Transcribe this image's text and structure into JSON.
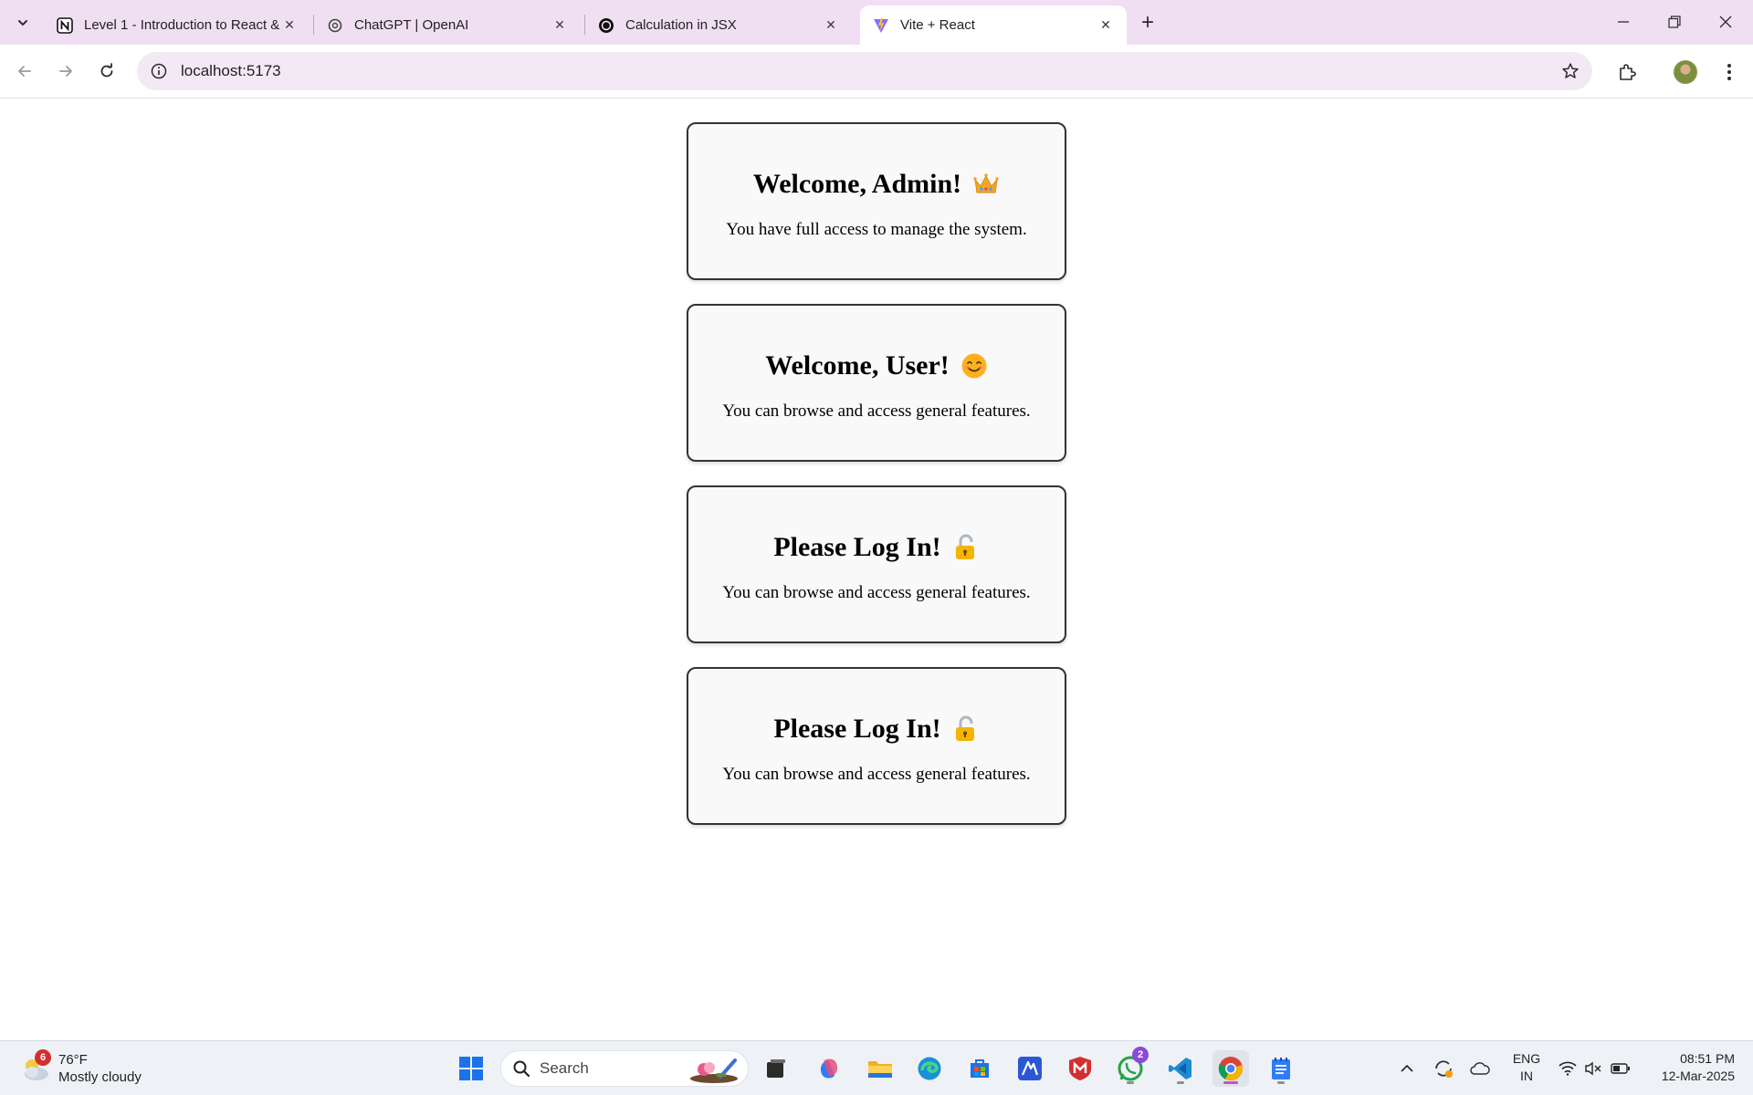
{
  "browser": {
    "tabs": [
      {
        "title": "Level 1 - Introduction to React & ",
        "favicon": "notion-icon",
        "active": false
      },
      {
        "title": "ChatGPT | OpenAI",
        "favicon": "openai-icon",
        "active": false
      },
      {
        "title": "Calculation in JSX",
        "favicon": "openai-icon",
        "active": false
      },
      {
        "title": "Vite + React",
        "favicon": "vite-icon",
        "active": true
      }
    ],
    "url": "localhost:5173"
  },
  "cards": [
    {
      "title": "Welcome, Admin!",
      "emoji": "crown-icon",
      "text": "You have full access to manage the system."
    },
    {
      "title": "Welcome, User!",
      "emoji": "smiling-face-icon",
      "text": "You can browse and access general features."
    },
    {
      "title": "Please Log In!",
      "emoji": "lock-icon",
      "text": "You can browse and access general features."
    },
    {
      "title": "Please Log In!",
      "emoji": "lock-icon",
      "text": "You can browse and access general features."
    }
  ],
  "taskbar": {
    "weather": {
      "temp": "76°F",
      "condition": "Mostly cloudy",
      "badge": "6"
    },
    "search_label": "Search",
    "whatsapp_badge": "2",
    "language": {
      "line1": "ENG",
      "line2": "IN"
    },
    "clock": {
      "time": "08:51 PM",
      "date": "12-Mar-2025"
    }
  },
  "colors": {
    "tabstrip": "#f0dff2",
    "omnibox": "#f3e9f4",
    "card_bg": "#f9f9f9",
    "card_border": "#333333"
  }
}
